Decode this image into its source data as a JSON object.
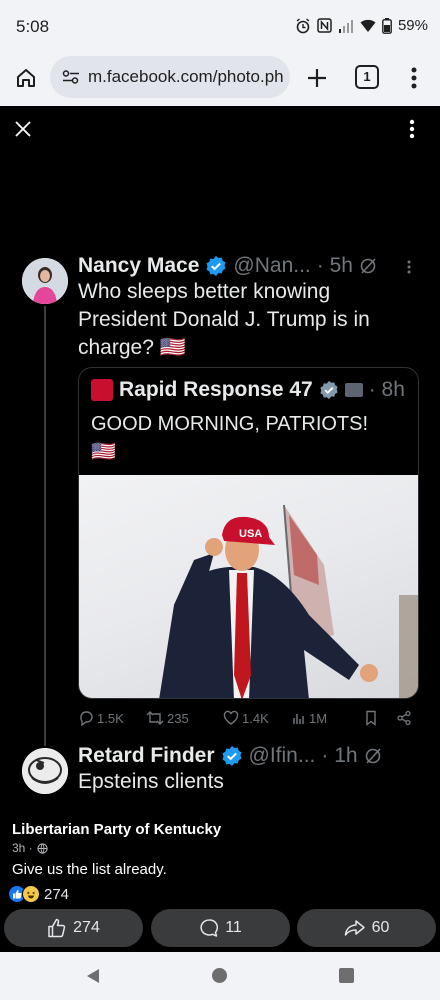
{
  "status_bar": {
    "time": "5:08",
    "battery": "59%",
    "icons": [
      "alarm-icon",
      "nfc-icon",
      "signal-icon",
      "wifi-icon",
      "battery-icon"
    ]
  },
  "browser": {
    "url": "m.facebook.com/photo.ph",
    "tab_count": "1"
  },
  "tweet1": {
    "name": "Nancy Mace",
    "handle": "@Nan...",
    "time": "· 5h",
    "body": "Who sleeps better knowing President Donald J. Trump is in charge? 🇺🇸"
  },
  "quote": {
    "name": "Rapid Response 47",
    "time": "· 8h",
    "body": "GOOD MORNING, PATRIOTS!",
    "flag": "🇺🇸",
    "cap_text": "USA"
  },
  "tweet_actions": {
    "replies": "1.5K",
    "reposts": "235",
    "likes": "1.4K",
    "views": "1M"
  },
  "tweet2": {
    "name": "Retard Finder",
    "handle": "@Ifin...",
    "time": "· 1h",
    "body": "Epsteins clients"
  },
  "fb_post": {
    "page_name": "Libertarian Party of Kentucky",
    "age": "3h ·",
    "caption": "Give us the list already.",
    "reaction_count": "274",
    "like_count": "274",
    "comment_count": "11",
    "share_count": "60"
  },
  "colors": {
    "verified": "#1d9bf0",
    "fb_like": "#1877f2",
    "muted": "#71767b"
  }
}
